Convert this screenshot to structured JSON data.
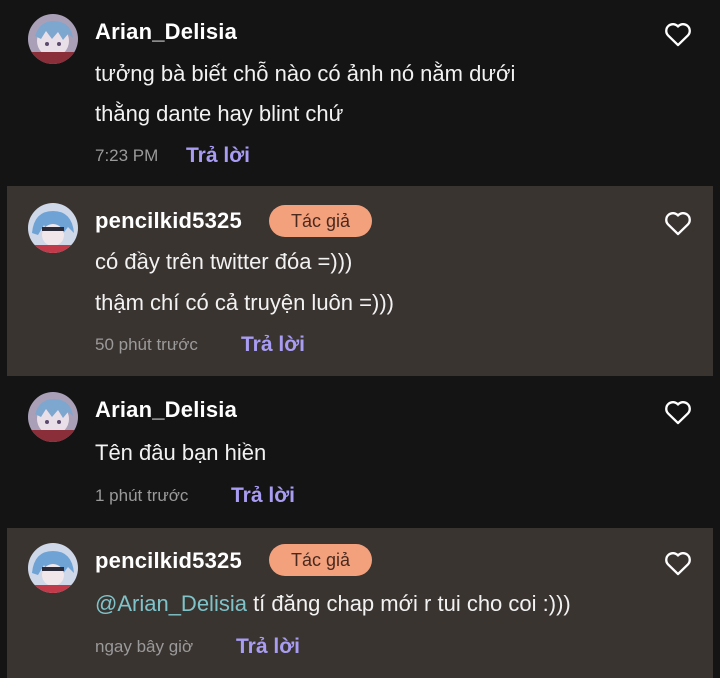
{
  "comments": [
    {
      "username": "Arian_Delisia",
      "lines": [
        "tưởng bà biết chỗ nào có ảnh nó nằm dưới",
        "thằng dante hay blint chứ"
      ],
      "time": "7:23 PM",
      "reply_label": "Trả lời"
    },
    {
      "username": "pencilkid5325",
      "badge": "Tác giả",
      "lines": [
        "có đầy trên twitter đóa =)))",
        "thậm chí có cả truyện luôn =)))"
      ],
      "time": "50 phút trước",
      "reply_label": "Trả lời"
    },
    {
      "username": "Arian_Delisia",
      "lines": [
        "Tên đâu bạn hiền"
      ],
      "time": "1 phút trước",
      "reply_label": "Trả lời"
    },
    {
      "username": "pencilkid5325",
      "badge": "Tác giả",
      "mention": "@Arian_Delisia",
      "lines": [
        " tí đăng chap mới r tui cho coi :)))"
      ],
      "time": "ngay bây giờ",
      "reply_label": "Trả lời"
    }
  ],
  "colors": {
    "background": "#141414",
    "highlight_bg": "#3a3431",
    "badge_bg": "#f3a07d",
    "reply": "#a89cf3",
    "mention": "#7fc3c9",
    "meta": "#9a9a9a"
  },
  "icons": {
    "like": "heart-outline-icon",
    "avatar": "anime-avatar"
  }
}
